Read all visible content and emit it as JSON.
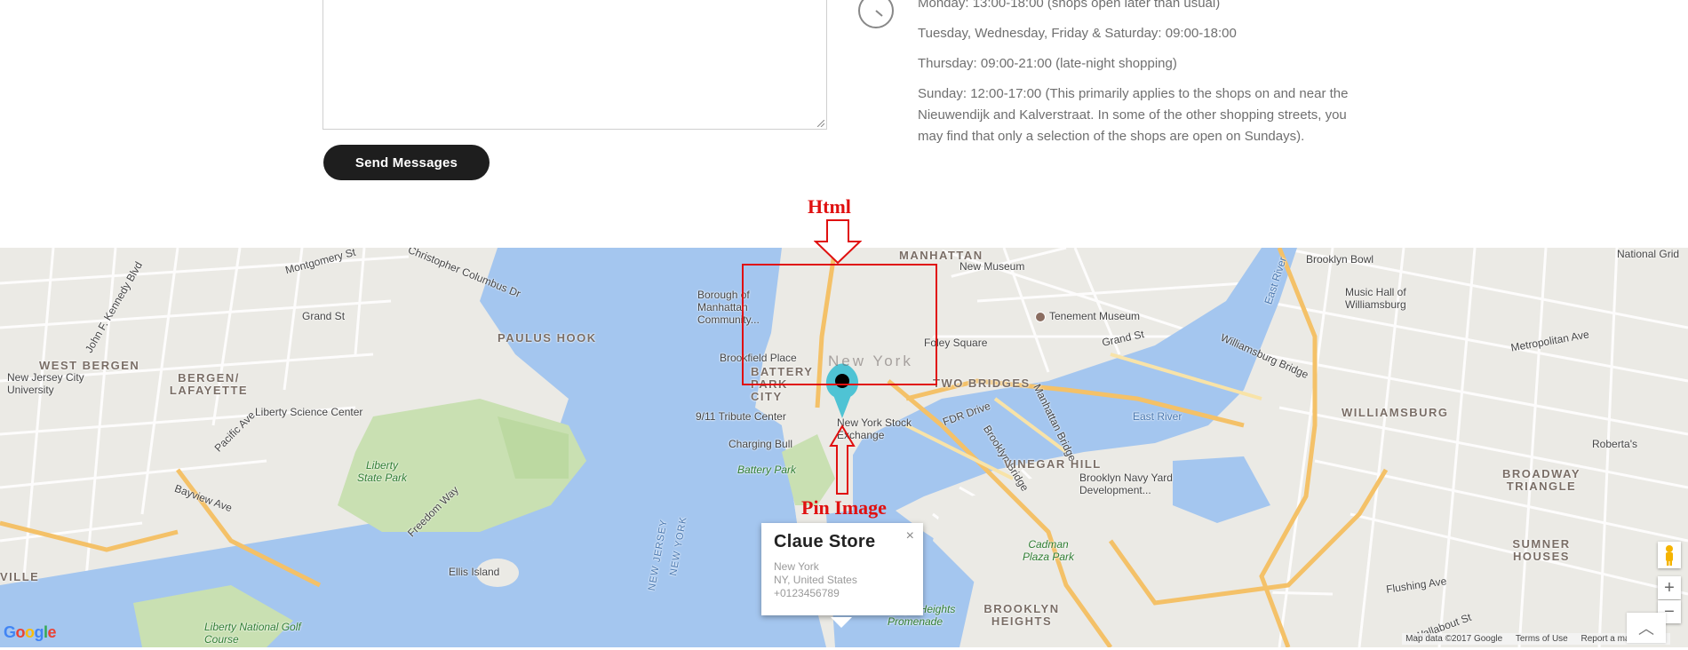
{
  "contact": {
    "send_button": "Send Messages",
    "hours": [
      "Monday: 13:00-18:00 (shops open later than usual)",
      "Tuesday, Wednesday, Friday & Saturday: 09:00-18:00",
      "Thursday: 09:00-21:00 (late-night shopping)",
      "Sunday: 12:00-17:00 (This primarily applies to the shops on and near the Nieuwendijk and Kalverstraat. In some of the other shopping streets, you may find that only a selection of the shops are open on Sundays)."
    ],
    "clock_icon": "clock-icon"
  },
  "annotations": {
    "html_label": "Html",
    "pin_label": "Pin Image",
    "color": "#e01010"
  },
  "map": {
    "info_window": {
      "title": "Claue Store",
      "line1": "New York",
      "line2": "NY, United States",
      "line3": "+0123456789",
      "close": "×"
    },
    "pin_color": "#4fc3d4",
    "labels": {
      "manhattan": "MANHATTAN",
      "new_museum": "New Museum",
      "tenement": "Tenement Museum",
      "brooklyn_bowl": "Brooklyn Bowl",
      "music_hall": "Music Hall of Williamsburg",
      "national_grid": "National Grid",
      "borough": "Borough of Manhattan Community...",
      "paulus_hook": "PAULUS HOOK",
      "grand_st_left": "Grand St",
      "grand_st_mid": "Grand St",
      "west_bergen": "WEST BERGEN",
      "bergen_lafayette": "BERGEN/ LAFAYETTE",
      "njcu": "New Jersey City University",
      "liberty_science": "Liberty Science Center",
      "liberty_park": "Liberty State Park",
      "ellis": "Ellis Island",
      "liberty_golf": "Liberty National Golf Course",
      "brookfield": "Brookfield Place",
      "battery_park_city": "BATTERY PARK CITY",
      "tribute": "9/11 Tribute Center",
      "charging_bull": "Charging Bull",
      "battery_park": "Battery Park",
      "nyse": "New York Stock Exchange",
      "foley": "Foley Square",
      "two_bridges": "TWO BRIDGES",
      "fdr": "FDR Drive",
      "east_river": "East River",
      "east_river_v": "East River",
      "manhattan_bridge": "Manhattan Bridge",
      "williamsburg_bridge": "Williamsburg Bridge",
      "brooklyn_bridge": "Brooklyn Bridge",
      "vinegar_hill": "VINEGAR HILL",
      "navy_yard": "Brooklyn Navy Yard Development...",
      "williamsburg": "WILLIAMSBURG",
      "broadway_triangle": "BROADWAY TRIANGLE",
      "robertas": "Roberta's",
      "sumner": "SUMNER HOUSES",
      "cadman": "Cadman Plaza Park",
      "brooklyn_heights": "BROOKLYN HEIGHTS",
      "promenade": "Brooklyn Heights Promenade",
      "ghost_ny": "New York",
      "metropolitan": "Metropolitan Ave",
      "flushing": "Flushing Ave",
      "wallabout": "Wallabout St",
      "montgomery": "Montgomery St",
      "columbus": "Christopher Columbus Dr",
      "jfk": "John F. Kennedy Blvd",
      "pacific": "Pacific Ave",
      "bayview": "Bayview Ave",
      "freedom": "Freedom Way",
      "new_jersey": "NEW JERSEY",
      "new_york_water": "NEW YORK",
      "ville": "VILLE"
    },
    "zoom_in": "+",
    "zoom_out": "−",
    "scroll_top": "︿",
    "google": [
      "G",
      "o",
      "o",
      "g",
      "l",
      "e"
    ],
    "google_colors": [
      "#4285f4",
      "#ea4335",
      "#fbbc05",
      "#4285f4",
      "#34a853",
      "#ea4335"
    ],
    "attribution": [
      "Map data ©2017 Google",
      "Terms of Use",
      "Report a map error"
    ]
  }
}
